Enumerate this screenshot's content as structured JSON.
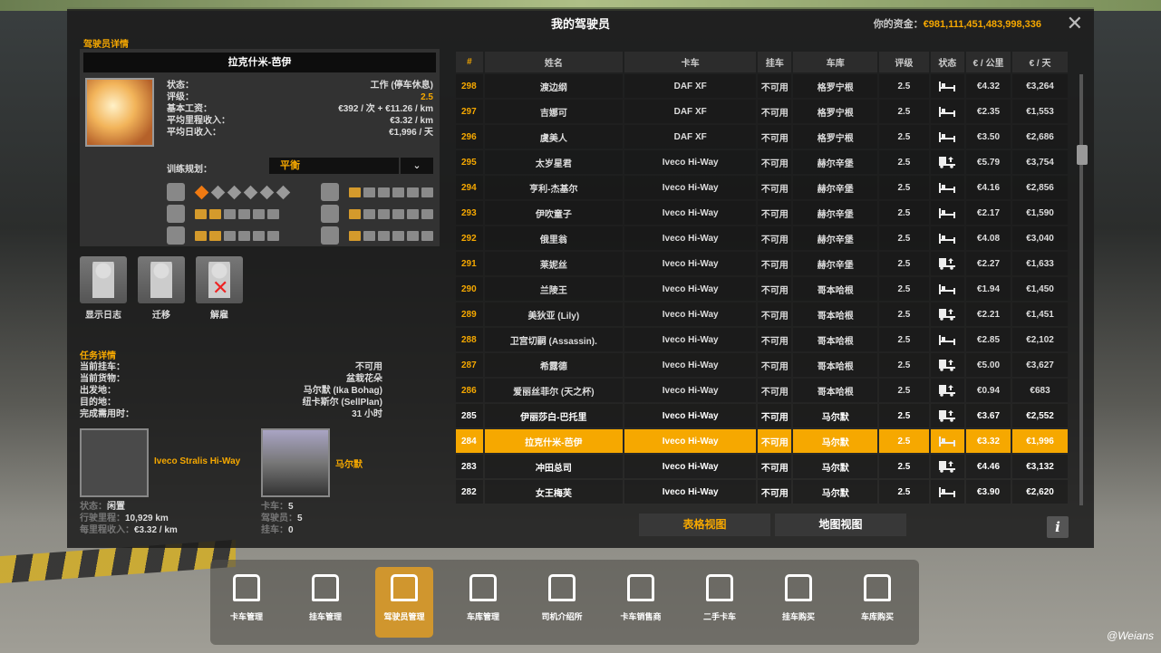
{
  "window": {
    "title": "我的驾驶员",
    "funds_label": "你的资金：",
    "funds_value": "€981,111,451,483,998,336"
  },
  "driver": {
    "section": "驾驶员详情",
    "name": "拉克什米-芭伊",
    "fields": [
      {
        "k": "状态：",
        "v": "工作 (停车休息)"
      },
      {
        "k": "评级：",
        "v": "2.5"
      },
      {
        "k": "基本工资：",
        "v": "€392 / 次 + €11.26 / km"
      },
      {
        "k": "平均里程收入：",
        "v": "€3.32 / km"
      },
      {
        "k": "平均日收入：",
        "v": "€1,996 / 天"
      }
    ],
    "training_label": "训练规划：",
    "training_value": "平衡",
    "skills": {
      "adr": 1,
      "distance": 2,
      "high_value": 2,
      "fragile": 1,
      "urgent": 1,
      "eco": 1
    },
    "actions": [
      "显示日志",
      "迁移",
      "解雇"
    ]
  },
  "task": {
    "section": "任务详情",
    "fields": [
      {
        "k": "当前挂车：",
        "v": "不可用"
      },
      {
        "k": "当前货物：",
        "v": "盆栽花朵"
      },
      {
        "k": "出发地：",
        "v": "马尔默 (Ika Bohag)"
      },
      {
        "k": "目的地：",
        "v": "纽卡斯尔 (SellPlan)"
      },
      {
        "k": "完成需用时：",
        "v": "31 小时"
      }
    ]
  },
  "truck": {
    "name": "Iveco Stralis Hi-Way",
    "status_k": "状态：",
    "status_v": "闲置",
    "km_k": "行驶里程：",
    "km_v": "10,929 km",
    "inc_k": "每里程收入：",
    "inc_v": "€3.32 / km"
  },
  "garage": {
    "name": "马尔默",
    "trucks_k": "卡车：",
    "trucks_v": "5",
    "drivers_k": "驾驶员：",
    "drivers_v": "5",
    "trailers_k": "挂车：",
    "trailers_v": "0"
  },
  "table": {
    "headers": [
      "#",
      "姓名",
      "卡车",
      "挂车",
      "车库",
      "评级",
      "状态",
      "€ / 公里",
      "€ / 天"
    ],
    "rows": [
      [
        "298",
        "渡边纲",
        "DAF XF",
        "不可用",
        "格罗宁根",
        "2.5",
        "bed",
        "€4.32",
        "€3,264"
      ],
      [
        "297",
        "吉娜可",
        "DAF XF",
        "不可用",
        "格罗宁根",
        "2.5",
        "bed",
        "€2.35",
        "€1,553"
      ],
      [
        "296",
        "虞美人",
        "DAF XF",
        "不可用",
        "格罗宁根",
        "2.5",
        "bed",
        "€3.50",
        "€2,686"
      ],
      [
        "295",
        "太岁星君",
        "Iveco Hi-Way",
        "不可用",
        "赫尔辛堡",
        "2.5",
        "truck",
        "€5.79",
        "€3,754"
      ],
      [
        "294",
        "亨利-杰基尔",
        "Iveco Hi-Way",
        "不可用",
        "赫尔辛堡",
        "2.5",
        "bed",
        "€4.16",
        "€2,856"
      ],
      [
        "293",
        "伊吹童子",
        "Iveco Hi-Way",
        "不可用",
        "赫尔辛堡",
        "2.5",
        "bed",
        "€2.17",
        "€1,590"
      ],
      [
        "292",
        "俄里翁",
        "Iveco Hi-Way",
        "不可用",
        "赫尔辛堡",
        "2.5",
        "bed",
        "€4.08",
        "€3,040"
      ],
      [
        "291",
        "莱妮丝",
        "Iveco Hi-Way",
        "不可用",
        "赫尔辛堡",
        "2.5",
        "truck",
        "€2.27",
        "€1,633"
      ],
      [
        "290",
        "兰陵王",
        "Iveco Hi-Way",
        "不可用",
        "哥本哈根",
        "2.5",
        "bed",
        "€1.94",
        "€1,450"
      ],
      [
        "289",
        "美狄亚 (Lily)",
        "Iveco Hi-Way",
        "不可用",
        "哥本哈根",
        "2.5",
        "truck",
        "€2.21",
        "€1,451"
      ],
      [
        "288",
        "卫宫切嗣 (Assassin).",
        "Iveco Hi-Way",
        "不可用",
        "哥本哈根",
        "2.5",
        "bed",
        "€2.85",
        "€2,102"
      ],
      [
        "287",
        "希露德",
        "Iveco Hi-Way",
        "不可用",
        "哥本哈根",
        "2.5",
        "truck",
        "€5.00",
        "€3,627"
      ],
      [
        "286",
        "爱丽丝菲尔 (天之杯)",
        "Iveco Hi-Way",
        "不可用",
        "哥本哈根",
        "2.5",
        "truck",
        "€0.94",
        "€683"
      ],
      [
        "285",
        "伊丽莎白-巴托里",
        "Iveco Hi-Way",
        "不可用",
        "马尔默",
        "2.5",
        "truck",
        "€3.67",
        "€2,552"
      ],
      [
        "284",
        "拉克什米-芭伊",
        "Iveco Hi-Way",
        "不可用",
        "马尔默",
        "2.5",
        "bed",
        "€3.32",
        "€1,996"
      ],
      [
        "283",
        "冲田总司",
        "Iveco Hi-Way",
        "不可用",
        "马尔默",
        "2.5",
        "truck",
        "€4.46",
        "€3,132"
      ],
      [
        "282",
        "女王梅芙",
        "Iveco Hi-Way",
        "不可用",
        "马尔默",
        "2.5",
        "bed",
        "€3.90",
        "€2,620"
      ]
    ],
    "selected": "284",
    "current_garage": "马尔默"
  },
  "views": [
    "表格视图",
    "地图视图"
  ],
  "dock": [
    "卡车管理",
    "挂车管理",
    "驾驶员管理",
    "车库管理",
    "司机介绍所",
    "卡车销售商",
    "二手卡车",
    "挂车购买",
    "车库购买"
  ],
  "dock_active": 2,
  "watermark": "@Weians",
  "colors": {
    "accent": "#f6a800"
  }
}
